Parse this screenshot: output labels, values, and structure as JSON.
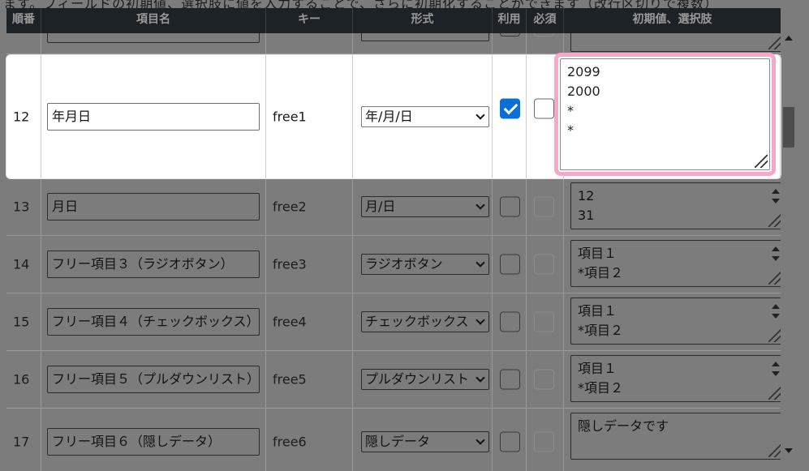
{
  "intro_text": "ます。フィールドの初期値、選択肢に値を入力することで、さらに初期化することができます（改行区切りで複数）",
  "headers": {
    "order": "順番",
    "item_name": "項目名",
    "key": "キー",
    "format": "形式",
    "use": "利用",
    "required": "必須",
    "initial": "初期値、選択肢"
  },
  "rows": [
    {
      "num": "",
      "name": "",
      "key": "",
      "format": "",
      "use": false,
      "required": false,
      "initial": [],
      "partial": true
    },
    {
      "num": "12",
      "name": "年月日",
      "key": "free1",
      "format": "年/月/日",
      "use": true,
      "required": false,
      "initial": [
        "2099",
        "2000",
        "*",
        "*"
      ],
      "highlighted": true
    },
    {
      "num": "13",
      "name": "月日",
      "key": "free2",
      "format": "月/日",
      "use": false,
      "required": false,
      "initial": [
        "12",
        "31"
      ]
    },
    {
      "num": "14",
      "name": "フリー項目３（ラジオボタン）",
      "key": "free3",
      "format": "ラジオボタン",
      "use": false,
      "required": false,
      "initial": [
        "項目１",
        "*項目２"
      ]
    },
    {
      "num": "15",
      "name": "フリー項目４（チェックボックス）",
      "key": "free4",
      "format": "チェックボックス",
      "use": false,
      "required": false,
      "initial": [
        "項目１",
        "*項目２"
      ]
    },
    {
      "num": "16",
      "name": "フリー項目５（プルダウンリスト）",
      "key": "free5",
      "format": "プルダウンリスト",
      "use": false,
      "required": false,
      "initial": [
        "項目１",
        "*項目２"
      ]
    },
    {
      "num": "17",
      "name": "フリー項目６（隠しデータ）",
      "key": "free6",
      "format": "隠しデータ",
      "use": false,
      "required": false,
      "initial": [
        "隠しデータです"
      ]
    }
  ],
  "colors": {
    "header_bg": "#1d2226",
    "overlay_gray": "#7c7c7c",
    "highlight_border": "#f7a8c8",
    "checkbox_checked": "#0a6fd6"
  }
}
